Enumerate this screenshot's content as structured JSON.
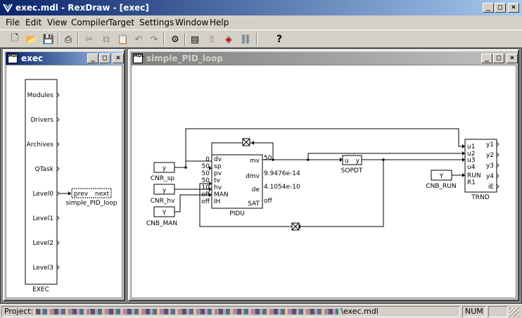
{
  "app": {
    "title": "exec.mdl - RexDraw - [exec]"
  },
  "window_controls": {
    "minimize": "_",
    "maximize": "□",
    "close": "×"
  },
  "menu": [
    "File",
    "Edit",
    "View",
    "Compiler",
    "Target",
    "Settings",
    "Window",
    "Help"
  ],
  "toolbar": [
    {
      "icon": "new-file-icon",
      "glyph": "🗋"
    },
    {
      "icon": "open-folder-icon",
      "glyph": "📂"
    },
    {
      "icon": "save-icon",
      "glyph": "💾"
    },
    {
      "icon": "print-icon",
      "glyph": "⎙"
    },
    {
      "icon": "cut-icon",
      "glyph": "✂"
    },
    {
      "icon": "copy-icon",
      "glyph": "⧉"
    },
    {
      "icon": "paste-icon",
      "glyph": "📋"
    },
    {
      "icon": "undo-icon",
      "glyph": "↶"
    },
    {
      "icon": "redo-icon",
      "glyph": "↷"
    },
    {
      "icon": "compile-icon",
      "glyph": "⚙"
    },
    {
      "icon": "diagnostics-icon",
      "glyph": "▤"
    },
    {
      "icon": "upload-icon",
      "glyph": "⇧"
    },
    {
      "icon": "watch-icon",
      "glyph": "◈"
    },
    {
      "icon": "connect-icon",
      "glyph": "⛓"
    },
    {
      "icon": "help-icon",
      "glyph": "?"
    }
  ],
  "exec_window": {
    "title": "exec",
    "block_name": "EXEC",
    "outputs": [
      "Modules",
      "Drivers",
      "Archives",
      "QTask",
      "Level0",
      "Level1",
      "Level2",
      "Level3"
    ],
    "task": {
      "left": "prev",
      "right": "next",
      "name": "simple_PID_loop"
    }
  },
  "pid_window": {
    "title": "simple_PID_loop",
    "blocks": {
      "cnr_sp": {
        "label": "y",
        "name": "CNR_sp"
      },
      "cnr_hv": {
        "label": "y",
        "name": "CNR_hv"
      },
      "cnb_man": {
        "label": "Y",
        "name": "CNB_MAN"
      },
      "cnb_run": {
        "label": "Y",
        "name": "CNB_RUN"
      },
      "pidu": {
        "name": "PIDU",
        "inputs": [
          "dv",
          "sp",
          "pv",
          "tv",
          "hv",
          "MAN",
          "IH"
        ],
        "input_values": [
          "0",
          "50",
          "50",
          "50",
          "10",
          "off",
          "off"
        ],
        "outputs": [
          "mv",
          "dmv",
          "de",
          "SAT"
        ],
        "output_values": [
          "50",
          "9.9476e-14",
          "4.1054e-10",
          "off"
        ]
      },
      "sopdt": {
        "name": "SOPDT",
        "in": "u",
        "out": "y"
      },
      "trnd": {
        "name": "TRND",
        "inputs": [
          "u1",
          "u2",
          "u3",
          "u4",
          "RUN",
          "R1"
        ],
        "outputs": [
          "y1",
          "y2",
          "y3",
          "y4",
          "iE"
        ]
      }
    }
  },
  "status": {
    "project_label": "Project:",
    "path": "\\exec.mdl",
    "num": "NUM"
  }
}
